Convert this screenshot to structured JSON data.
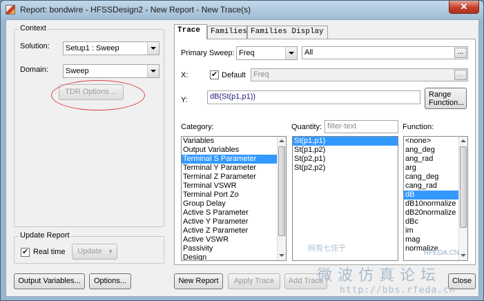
{
  "window": {
    "title": "Report: bondwire - HFSSDesign2 - New Report - New Trace(s)",
    "close_glyph": "✕"
  },
  "context": {
    "group_label": "Context",
    "solution_label": "Solution:",
    "solution_value": "Setup1 : Sweep",
    "domain_label": "Domain:",
    "domain_value": "Sweep",
    "tdr_button": "TDR Options ..."
  },
  "update_report": {
    "group_label": "Update Report",
    "realtime_label": "Real time",
    "realtime_checked": true,
    "update_button": "Update"
  },
  "tabs": [
    {
      "label": "Trace",
      "active": true
    },
    {
      "label": "Families",
      "active": false
    },
    {
      "label": "Families Display",
      "active": false
    }
  ],
  "trace": {
    "primary_sweep_label": "Primary Sweep:",
    "primary_sweep_value": "Freq",
    "primary_sweep_range": "All",
    "dots": "...",
    "x_label": "X:",
    "default_label": "Default",
    "default_checked": true,
    "x_value": "Freq",
    "y_label": "Y:",
    "y_value": "dB(St(p1,p1))",
    "range_function_button": "Range\nFunction..."
  },
  "category": {
    "label": "Category:",
    "items": [
      "Variables",
      "Output Variables",
      "Terminal S Parameter",
      "Terminal Y Parameter",
      "Terminal Z Parameter",
      "Terminal VSWR",
      "Terminal Port Zo",
      "Group Delay",
      "Active S Parameter",
      "Active Y Parameter",
      "Active Z Parameter",
      "Active VSWR",
      "Passivity",
      "Design"
    ],
    "selected": "Terminal S Parameter"
  },
  "quantity": {
    "label": "Quantity:",
    "filter_placeholder": "filter-text",
    "items": [
      "St(p1,p1)",
      "St(p1,p2)",
      "St(p2,p1)",
      "St(p2,p2)"
    ],
    "selected": "St(p1,p1)"
  },
  "function": {
    "label": "Function:",
    "items": [
      "<none>",
      "ang_deg",
      "ang_rad",
      "arg",
      "cang_deg",
      "cang_rad",
      "dB",
      "dB10normalize",
      "dB20normalize",
      "dBc",
      "im",
      "mag",
      "normalize"
    ],
    "selected": "dB"
  },
  "buttons": {
    "output_variables": "Output Variables...",
    "options": "Options...",
    "new_report": "New Report",
    "apply_trace": "Apply Trace",
    "add_trace": "Add Trace",
    "close": "Close"
  },
  "watermarks": {
    "cn_small": "网有七佳于",
    "rfeda_mark": "RFEDA.CN",
    "cn_large": "微波仿真论坛",
    "url": "http://bbs.rfeda.cn"
  }
}
